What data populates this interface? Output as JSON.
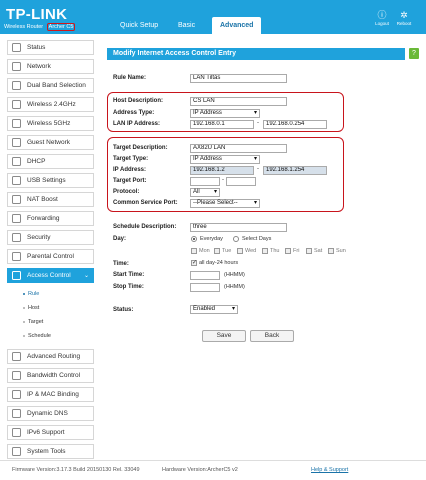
{
  "header": {
    "logo": "TP-LINK",
    "subtitle": "Wireless Router",
    "model": "Archer C5",
    "tabs": [
      "Quick Setup",
      "Basic",
      "Advanced"
    ],
    "logout_label": "Logout",
    "reboot_label": "Reboot",
    "accent_color": "#1fa2dc"
  },
  "sidebar": {
    "items": [
      {
        "label": "Status",
        "icon": "status-icon"
      },
      {
        "label": "Network",
        "icon": "network-icon"
      },
      {
        "label": "Dual Band Selection",
        "icon": "dual-band-icon"
      },
      {
        "label": "Wireless 2.4GHz",
        "icon": "wireless-icon"
      },
      {
        "label": "Wireless 5GHz",
        "icon": "wireless-icon"
      },
      {
        "label": "Guest Network",
        "icon": "guest-icon"
      },
      {
        "label": "DHCP",
        "icon": "dhcp-icon"
      },
      {
        "label": "USB Settings",
        "icon": "usb-icon"
      },
      {
        "label": "NAT Boost",
        "icon": "nat-icon"
      },
      {
        "label": "Forwarding",
        "icon": "forwarding-icon"
      },
      {
        "label": "Security",
        "icon": "shield-icon"
      },
      {
        "label": "Parental Control",
        "icon": "parental-icon"
      },
      {
        "label": "Access Control",
        "icon": "access-control-icon"
      },
      {
        "label": "Advanced Routing",
        "icon": "routing-icon"
      },
      {
        "label": "Bandwidth Control",
        "icon": "bandwidth-icon"
      },
      {
        "label": "IP & MAC Binding",
        "icon": "binding-icon"
      },
      {
        "label": "Dynamic DNS",
        "icon": "ddns-icon"
      },
      {
        "label": "IPv6 Support",
        "icon": "ipv6-icon"
      },
      {
        "label": "System Tools",
        "icon": "tools-icon"
      }
    ],
    "sub_items": [
      "Rule",
      "Host",
      "Target",
      "Schedule"
    ]
  },
  "form": {
    "title": "Modify Internet Access Control Entry",
    "help": "?",
    "rule_name_label": "Rule Name:",
    "rule_name_value": "LAN Tiltás",
    "host_description_label": "Host Description:",
    "host_description_value": "CS LAN",
    "host_address_type_label": "Address Type:",
    "host_address_type_value": "IP Address",
    "lan_ip_label": "LAN IP Address:",
    "lan_ip_start": "192.168.0.1",
    "lan_ip_end": "192.168.0.254",
    "target_description_label": "Target Description:",
    "target_description_value": "AX82U LAN",
    "target_type_label": "Target Type:",
    "target_type_value": "IP Address",
    "ip_address_label": "IP Address:",
    "target_ip_start": "192.168.1.2",
    "target_ip_end": "192.168.1.254",
    "target_port_label": "Target Port:",
    "target_port_start": "",
    "target_port_end": "",
    "protocol_label": "Protocol:",
    "protocol_value": "All",
    "common_service_label": "Common Service Port:",
    "common_service_value": "--Please Select--",
    "schedule_description_label": "Schedule Description:",
    "schedule_description_value": "three",
    "day_label": "Day:",
    "everyday_label": "Everyday",
    "select_days_label": "Select Days",
    "days": [
      "Mon",
      "Tue",
      "Wed",
      "Thu",
      "Fri",
      "Sat",
      "Sun"
    ],
    "time_label": "Time:",
    "all_day_label": "all day-24 hours",
    "start_time_label": "Start Time:",
    "stop_time_label": "Stop Time:",
    "time_hint": "(HHMM)",
    "status_label": "Status:",
    "status_value": "Enabled",
    "save_label": "Save",
    "back_label": "Back"
  },
  "footer": {
    "firmware": "Firmware Version:3.17.3 Build 20150130 Rel. 33049",
    "hardware": "Hardware Version:ArcherC5 v2",
    "help_link": "Help & Support"
  }
}
